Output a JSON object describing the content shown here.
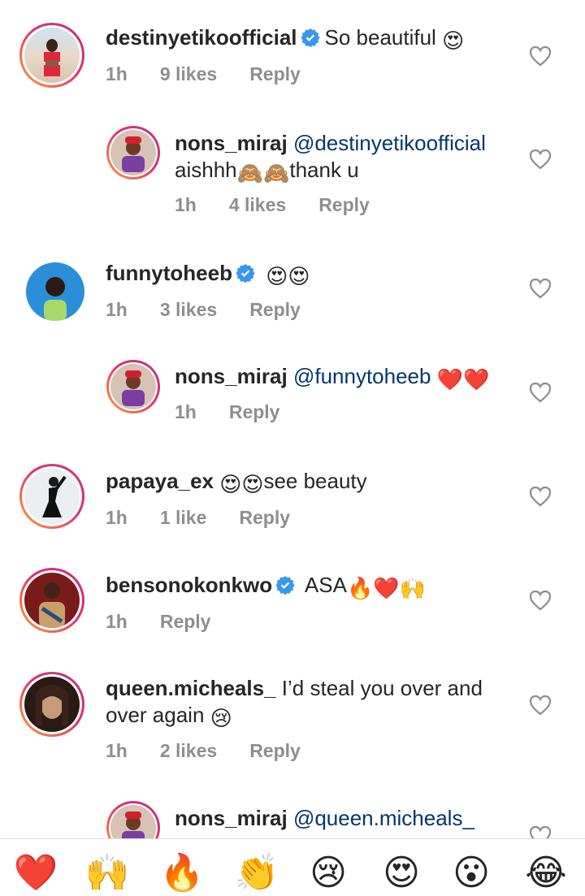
{
  "comments": [
    {
      "username": "destinyetikoofficial",
      "verified": true,
      "text": "So beautiful",
      "emoji": "😍",
      "time": "1h",
      "likes": "9 likes",
      "reply": "Reply"
    },
    {
      "username": "nons_miraj",
      "mention": "@destinyetikoofficial",
      "line2": "aishhh",
      "line2_end": "thank u",
      "time": "1h",
      "likes": "4 likes",
      "reply": "Reply"
    },
    {
      "username": "funnytoheeb",
      "verified": true,
      "text": "",
      "emoji": "😍😍",
      "time": "1h",
      "likes": "3 likes",
      "reply": "Reply"
    },
    {
      "username": "nons_miraj",
      "mention": "@funnytoheeb",
      "emoji": "❤️❤️",
      "time": "1h",
      "reply": "Reply"
    },
    {
      "username": "papaya_ex",
      "emoji": "😍😍",
      "text": "see beauty",
      "time": "1h",
      "likes": "1 like",
      "reply": "Reply"
    },
    {
      "username": "bensonokonkwo",
      "verified": true,
      "text": "ASA",
      "emoji": "🔥❤️🙌",
      "time": "1h",
      "reply": "Reply"
    },
    {
      "username": "queen.micheals_",
      "text": "I’d steal you over and",
      "line2": "over again",
      "emoji": "😢",
      "time": "1h",
      "likes": "2 likes",
      "reply": "Reply"
    },
    {
      "username": "nons_miraj",
      "mention": "@queen.micheals_"
    }
  ],
  "reactions": [
    {
      "name": "red-heart",
      "glyph": "❤️"
    },
    {
      "name": "raising-hands",
      "glyph": "🙌"
    },
    {
      "name": "fire",
      "glyph": "🔥"
    },
    {
      "name": "clapping-hands",
      "glyph": "👏"
    },
    {
      "name": "crying-face",
      "glyph": "😢"
    },
    {
      "name": "heart-eyes",
      "glyph": "😍"
    },
    {
      "name": "surprised-face",
      "glyph": "😮"
    },
    {
      "name": "tears-of-joy",
      "glyph": "😂"
    }
  ],
  "colors": {
    "text": "#262626",
    "meta": "#8e8e8e",
    "mention": "#00376b",
    "verified": "#3897f0"
  }
}
